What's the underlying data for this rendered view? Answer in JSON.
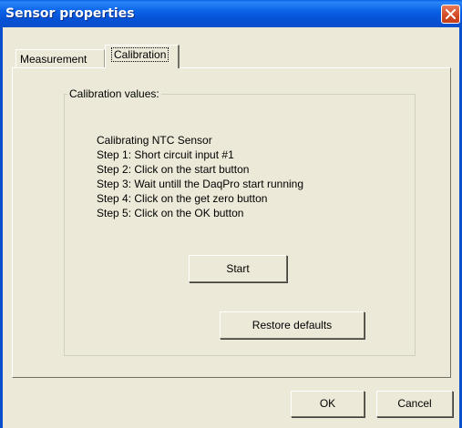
{
  "window": {
    "title": "Sensor properties",
    "colors": {
      "titlebar": "#0a5fe6",
      "close_button": "#d24a25",
      "face": "#ece9d8"
    }
  },
  "tabs": [
    {
      "label": "Measurement",
      "selected": false
    },
    {
      "label": "Calibration",
      "selected": true
    }
  ],
  "calibration": {
    "group_label": "Calibration values:",
    "instructions": [
      "Calibrating NTC Sensor",
      "Step 1: Short circuit input #1",
      "Step 2: Click on the start button",
      "Step 3: Wait untill the DaqPro start running",
      "Step 4: Click on the get zero button",
      "Step 5: Click on the OK button"
    ],
    "start_label": "Start",
    "restore_label": "Restore defaults"
  },
  "footer": {
    "ok_label": "OK",
    "cancel_label": "Cancel"
  }
}
